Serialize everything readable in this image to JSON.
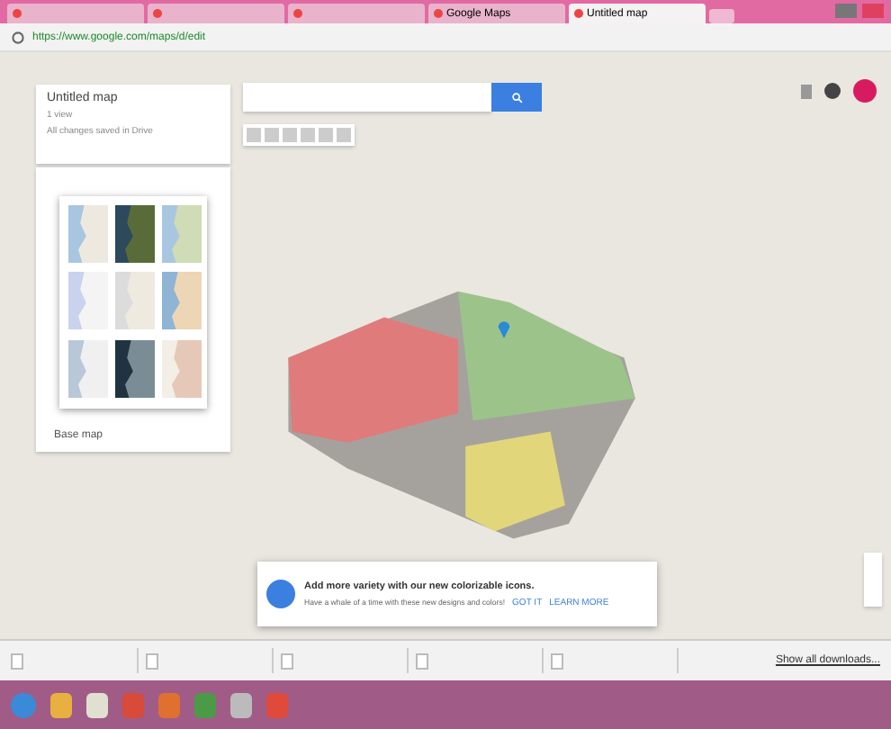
{
  "browser": {
    "tabs": [
      {
        "selected": false
      },
      {
        "selected": false
      },
      {
        "selected": false
      },
      {
        "title": "Google Maps",
        "selected": false
      },
      {
        "title": "Untitled map",
        "selected": true
      }
    ],
    "url": "https://www.google.com/maps/d/edit"
  },
  "map_panel": {
    "title": "Untitled map",
    "subtitle": "1 view",
    "status": "All changes saved in Drive",
    "base_map_label": "Base map",
    "base_maps": [
      {
        "kind": "map",
        "selected": false
      },
      {
        "kind": "satellite",
        "selected": false
      },
      {
        "kind": "terrain",
        "selected": false
      },
      {
        "kind": "light",
        "selected": false
      },
      {
        "kind": "mono",
        "selected": false
      },
      {
        "kind": "atlas",
        "selected": false
      },
      {
        "kind": "political",
        "selected": false
      },
      {
        "kind": "dark",
        "selected": false
      },
      {
        "kind": "landscape",
        "selected": false
      }
    ]
  },
  "polygons": [
    {
      "color": "#e07b7b"
    },
    {
      "color": "#9cc48a"
    },
    {
      "color": "#e2d67a"
    }
  ],
  "toast": {
    "title": "Add more variety with our new colorizable icons.",
    "text": "Have a whale of a time with these new designs and colors!",
    "buttons": [
      "GOT IT",
      "LEARN MORE"
    ]
  },
  "downloads": {
    "items": [
      {
        "kind": "file"
      },
      {
        "kind": "file"
      },
      {
        "kind": "file"
      },
      {
        "kind": "file"
      },
      {
        "kind": "file"
      }
    ],
    "show_all": "Show all downloads..."
  }
}
